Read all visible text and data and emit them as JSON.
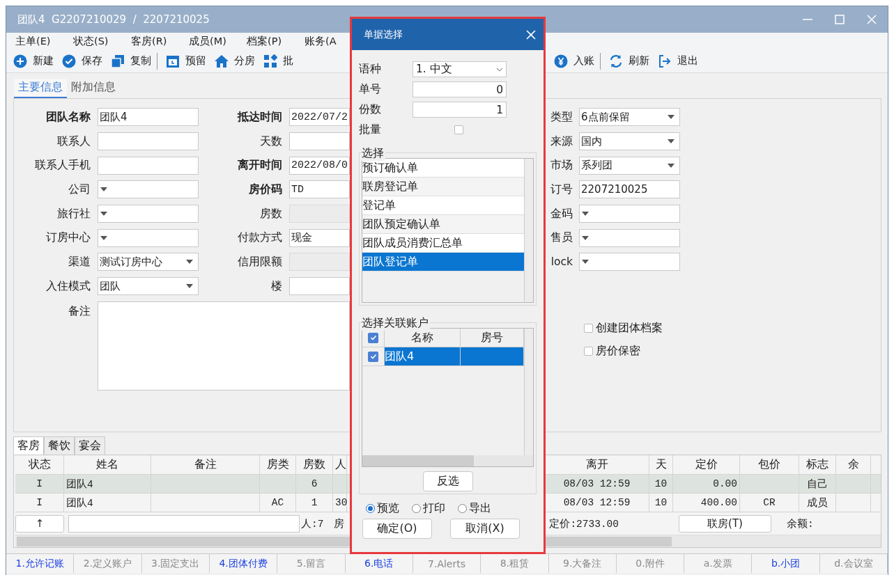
{
  "window": {
    "title": "团队4  G2207210029  /  2207210025"
  },
  "menu": [
    "主单(E)",
    "状态(S)",
    "客房(R)",
    "成员(M)",
    "档案(P)",
    "账务(A"
  ],
  "toolbar": {
    "items_left": [
      {
        "label": "新建",
        "kind": "add",
        "separator_after": false
      },
      {
        "label": "保存",
        "kind": "save",
        "separator_after": false
      },
      {
        "label": "复制",
        "kind": "copy",
        "separator_after": true
      },
      {
        "label": "预留",
        "kind": "reserve",
        "separator_after": false
      },
      {
        "label": "分房",
        "kind": "rooms",
        "separator_after": false
      },
      {
        "label": "批",
        "kind": "batch",
        "separator_after": false
      }
    ],
    "items_right": [
      {
        "label": "入账",
        "kind": "post",
        "separator_after": true
      },
      {
        "label": "刷新",
        "kind": "refresh",
        "separator_after": false
      },
      {
        "label": "退出",
        "kind": "exit",
        "separator_after": false
      }
    ]
  },
  "form_tabs": [
    {
      "label": "主要信息",
      "selected": true
    },
    {
      "label": "附加信息",
      "selected": false
    }
  ],
  "form": {
    "column_1": [
      {
        "label": "团队名称",
        "bold": true,
        "kind": "text",
        "value": "团队4"
      },
      {
        "label": "联系人",
        "bold": false,
        "kind": "text"
      },
      {
        "label": "联系人手机",
        "bold": false,
        "kind": "text"
      },
      {
        "label": "公司",
        "bold": false,
        "kind": "dropdown"
      },
      {
        "label": "旅行社",
        "bold": false,
        "kind": "dropdown"
      },
      {
        "label": "订房中心",
        "bold": false,
        "kind": "dropdown"
      },
      {
        "label": "渠道",
        "bold": false,
        "kind": "dropdown",
        "value": "测试订房中心"
      },
      {
        "label": "入住模式",
        "bold": false,
        "kind": "dropdown",
        "value": "团队"
      }
    ],
    "column_2": [
      {
        "label": "抵达时间",
        "bold": true,
        "kind": "text",
        "value": "2022/07/2"
      },
      {
        "label": "天数",
        "bold": false,
        "kind": "text"
      },
      {
        "label": "离开时间",
        "bold": true,
        "kind": "text",
        "value": "2022/08/0"
      },
      {
        "label": "房价码",
        "bold": true,
        "kind": "text",
        "value": "TD"
      },
      {
        "label": "房数",
        "bold": false,
        "kind": "disabled"
      },
      {
        "label": "付款方式",
        "bold": false,
        "kind": "text",
        "value": "现金"
      },
      {
        "label": "信用限额",
        "bold": false,
        "kind": "disabled"
      },
      {
        "label": "楼",
        "bold": false,
        "kind": "text"
      }
    ],
    "column_3": [
      {
        "label": "类型",
        "bold": false,
        "kind": "dropdown",
        "value": "6点前保留"
      },
      {
        "label": "来源",
        "bold": false,
        "kind": "dropdown",
        "value": "国内"
      },
      {
        "label": "市场",
        "bold": false,
        "kind": "dropdown",
        "value": "系列团"
      },
      {
        "label": "订号",
        "bold": false,
        "kind": "text",
        "value": "2207210025"
      },
      {
        "label": "金码",
        "bold": false,
        "kind": "dropdown"
      },
      {
        "label": "售员",
        "bold": false,
        "kind": "dropdown"
      },
      {
        "label": "lock",
        "bold": false,
        "kind": "dropdown"
      }
    ],
    "remarks": {
      "label": "备注"
    },
    "checkboxes": [
      {
        "label": "创建团体档案",
        "checked": false
      },
      {
        "label": "房价保密",
        "checked": false
      }
    ]
  },
  "detail_tabs": [
    {
      "label": "客房",
      "selected": true
    },
    {
      "label": "餐饮",
      "selected": false
    },
    {
      "label": "宴会",
      "selected": false
    }
  ],
  "table": {
    "columns_left": [
      "状态",
      "姓名",
      "备注",
      "房类",
      "房数",
      "人"
    ],
    "columns_right": [
      "离开",
      "天",
      "定价",
      "包价",
      "标志",
      "余"
    ],
    "rows": [
      {
        "selected": true,
        "left": {
          "status": "I",
          "name": "团队4",
          "rooms": "6"
        },
        "right": {
          "departure": "08/03 12:59",
          "days": "10",
          "price": "0.00",
          "flag": "自己"
        }
      },
      {
        "selected": false,
        "left": {
          "status": "I",
          "name": "团队4",
          "room_type": "AC",
          "rooms": "1",
          "column_6": "30"
        },
        "right": {
          "departure": "08/03 12:59",
          "days": "10",
          "price": "400.00",
          "package": "CR",
          "flag": "成员"
        }
      }
    ]
  },
  "summary": {
    "up_button": "↑",
    "count": "人:7",
    "column_cut": "房",
    "price_total": "定价:2733.00",
    "link_button": "联房(T)",
    "balance_label": "余额:"
  },
  "status_tabs": [
    {
      "label": "1.允许记账",
      "enabled": true
    },
    {
      "label": "2.定义账户",
      "enabled": false
    },
    {
      "label": "3.固定支出",
      "enabled": false
    },
    {
      "label": "4.团体付费",
      "enabled": true
    },
    {
      "label": "5.留言",
      "enabled": false
    },
    {
      "label": "6.电话",
      "enabled": true
    },
    {
      "label": "7.Alerts",
      "enabled": false
    },
    {
      "label": "8.租赁",
      "enabled": false
    },
    {
      "label": "9.大备注",
      "enabled": false
    },
    {
      "label": "0.附件",
      "enabled": false
    },
    {
      "label": "a.发票",
      "enabled": false
    },
    {
      "label": "b.小团",
      "enabled": true
    },
    {
      "label": "d.会议室",
      "enabled": false
    }
  ],
  "dialog": {
    "title": "单据选择",
    "language": {
      "label": "语种",
      "value": "1. 中文"
    },
    "number": {
      "label": "单号",
      "value": "0"
    },
    "copies": {
      "label": "份数",
      "value": "1"
    },
    "batch": {
      "label": "批量",
      "checked": false
    },
    "select_group": {
      "title": "选择",
      "items": [
        {
          "label": "预订确认单",
          "selected": false
        },
        {
          "label": "联房登记单",
          "selected": false
        },
        {
          "label": "登记单",
          "selected": false
        },
        {
          "label": "团队预定确认单",
          "selected": false
        },
        {
          "label": "团队成员消费汇总单",
          "selected": false
        },
        {
          "label": "团队登记单",
          "selected": true
        }
      ]
    },
    "accounts_group": {
      "title": "选择关联账户",
      "all_checked": true,
      "columns": [
        "名称",
        "房号"
      ],
      "rows": [
        {
          "checked": true,
          "selected": true,
          "name": "团队4"
        }
      ]
    },
    "invert_button": "反选",
    "output": [
      {
        "label": "预览",
        "selected": true
      },
      {
        "label": "打印",
        "selected": false
      },
      {
        "label": "导出",
        "selected": false
      }
    ],
    "buttons": [
      "确定(O)",
      "取消(X)"
    ]
  }
}
